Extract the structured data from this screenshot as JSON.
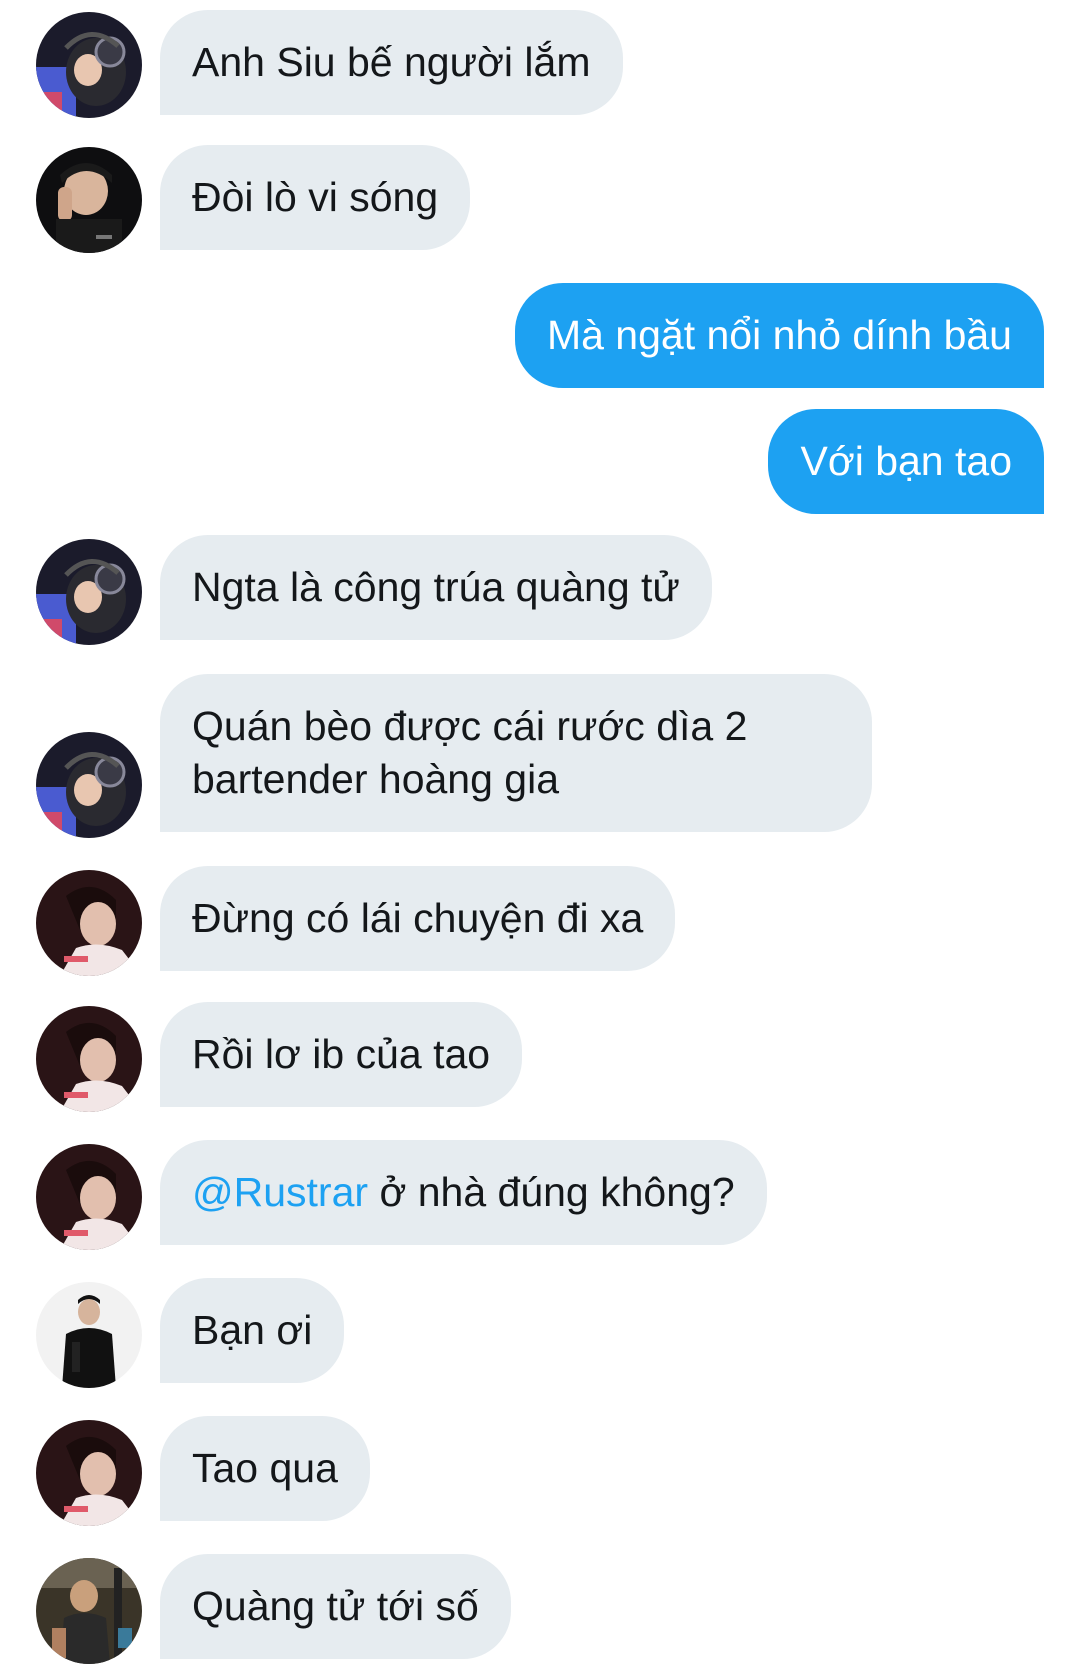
{
  "colors": {
    "incoming_bubble": "#e6ecf0",
    "outgoing_bubble": "#1da1f2",
    "mention": "#1da1f2",
    "text": "#14171a"
  },
  "messages": [
    {
      "direction": "incoming",
      "avatar": "avatar-headset-icon",
      "text": "Anh Siu bế người lắm"
    },
    {
      "direction": "incoming",
      "avatar": "avatar-hand-on-face-icon",
      "text": "Đòi lò vi sóng"
    },
    {
      "direction": "outgoing",
      "text": "Mà ngặt nổi nhỏ dính bầu"
    },
    {
      "direction": "outgoing",
      "text": "Với bạn tao"
    },
    {
      "direction": "incoming",
      "avatar": "avatar-headset-icon",
      "text": "Ngta là công trúa quàng tử"
    },
    {
      "direction": "incoming",
      "avatar": "avatar-headset-icon",
      "text": "Quán bèo được cái rước dìa 2 bartender hoàng gia"
    },
    {
      "direction": "incoming",
      "avatar": "avatar-profile-dark-icon",
      "text": "Đừng có lái chuyện đi xa"
    },
    {
      "direction": "incoming",
      "avatar": "avatar-profile-dark-icon",
      "text": "Rồi lơ ib của tao"
    },
    {
      "direction": "incoming",
      "avatar": "avatar-profile-dark-icon",
      "mention": "@Rustrar",
      "text": " ở nhà đúng không?"
    },
    {
      "direction": "incoming",
      "avatar": "avatar-black-jacket-icon",
      "text": "Bạn ơi"
    },
    {
      "direction": "incoming",
      "avatar": "avatar-profile-dark-icon",
      "text": "Tao qua"
    },
    {
      "direction": "incoming",
      "avatar": "avatar-gym-icon",
      "text": "Quàng tử tới số"
    }
  ]
}
